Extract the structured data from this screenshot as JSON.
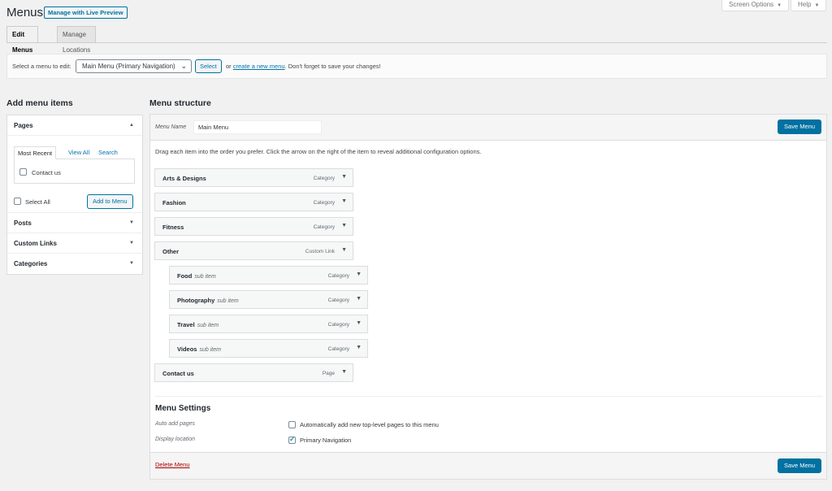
{
  "header": {
    "title": "Menus",
    "live_preview": "Manage with Live Preview",
    "screen_options": "Screen Options",
    "help": "Help",
    "caret": "▼"
  },
  "tabs": [
    {
      "label": "Edit Menus",
      "active": true
    },
    {
      "label": "Manage Locations",
      "active": false
    }
  ],
  "select_bar": {
    "label": "Select a menu to edit:",
    "selected": "Main Menu (Primary Navigation)",
    "select_button": "Select",
    "or": "or",
    "create_link": "create a new menu",
    "reminder": ". Don't forget to save your changes!"
  },
  "left": {
    "heading": "Add menu items",
    "pages": {
      "title": "Pages",
      "tabs": [
        "Most Recent",
        "View All",
        "Search"
      ],
      "items": [
        {
          "label": "Contact us",
          "checked": false
        }
      ],
      "select_all": "Select All",
      "add_button": "Add to Menu"
    },
    "sections": [
      "Posts",
      "Custom Links",
      "Categories"
    ],
    "arrow_up": "▲",
    "arrow_down": "▼"
  },
  "right": {
    "heading": "Menu structure",
    "name_label": "Menu Name",
    "name_value": "Main Menu",
    "save_button": "Save Menu",
    "instructions": "Drag each item into the order you prefer. Click the arrow on the right of the item to reveal additional configuration options.",
    "items": [
      {
        "title": "Arts & Designs",
        "sub": "",
        "type": "Category",
        "depth": 0
      },
      {
        "title": "Fashion",
        "sub": "",
        "type": "Category",
        "depth": 0
      },
      {
        "title": "Fitness",
        "sub": "",
        "type": "Category",
        "depth": 0
      },
      {
        "title": "Other",
        "sub": "",
        "type": "Custom Link",
        "depth": 0
      },
      {
        "title": "Food",
        "sub": "sub item",
        "type": "Category",
        "depth": 1
      },
      {
        "title": "Photography",
        "sub": "sub item",
        "type": "Category",
        "depth": 1
      },
      {
        "title": "Travel",
        "sub": "sub item",
        "type": "Category",
        "depth": 1
      },
      {
        "title": "Videos",
        "sub": "sub item",
        "type": "Category",
        "depth": 1
      },
      {
        "title": "Contact us",
        "sub": "",
        "type": "Page",
        "depth": 0
      }
    ],
    "settings": {
      "title": "Menu Settings",
      "auto_add_label": "Auto add pages",
      "auto_add_text": "Automatically add new top-level pages to this menu",
      "auto_add_checked": false,
      "location_label": "Display location",
      "location_text": "Primary Navigation",
      "location_checked": true
    },
    "delete_link": "Delete Menu"
  },
  "colors": {
    "primary": "#0071a1",
    "link": "#0073aa",
    "delete": "#aa0000",
    "background": "#f1f1f1"
  }
}
